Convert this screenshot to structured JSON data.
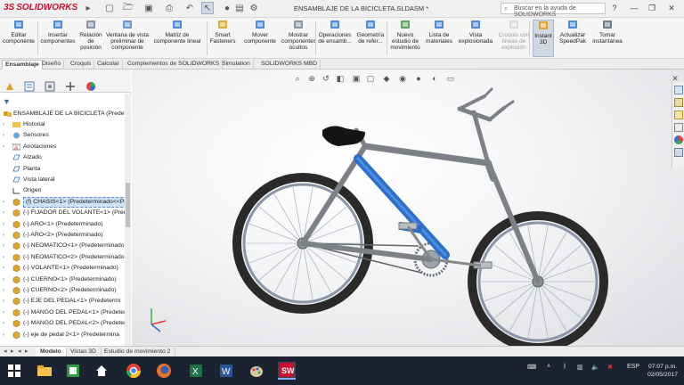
{
  "app": {
    "logo_prefix": "3S",
    "logo_text": "SOLIDWORKS"
  },
  "document_title": "ENSAMBLAJE DE LA BICICLETA.SLDASM *",
  "search": {
    "placeholder": "Buscar en la ayuda de SOLIDWORKS"
  },
  "ribbon": [
    {
      "label": "Editar componente",
      "icon": "edit-component-icon",
      "disabled": false
    },
    {
      "label": "Insertar componentes",
      "icon": "insert-components-icon",
      "disabled": false
    },
    {
      "label": "Relación de posición",
      "icon": "mate-icon",
      "disabled": false
    },
    {
      "label": "Ventana de vista preliminar de componente",
      "icon": "preview-window-icon",
      "disabled": false
    },
    {
      "label": "Matriz de componente lineal",
      "icon": "linear-pattern-icon",
      "disabled": false
    },
    {
      "label": "Smart Fasteners",
      "icon": "smart-fasteners-icon",
      "disabled": false
    },
    {
      "label": "Mover componente",
      "icon": "move-component-icon",
      "disabled": false
    },
    {
      "label": "Mostrar componentes ocultos",
      "icon": "show-hidden-icon",
      "disabled": false
    },
    {
      "label": "Operaciones de ensamb...",
      "icon": "assembly-features-icon",
      "disabled": false
    },
    {
      "label": "Geometría de refer...",
      "icon": "reference-geometry-icon",
      "disabled": false
    },
    {
      "label": "Nuevo estudio de movimiento",
      "icon": "motion-study-icon",
      "disabled": false
    },
    {
      "label": "Lista de materiales",
      "icon": "bom-icon",
      "disabled": false
    },
    {
      "label": "Vista explosionada",
      "icon": "exploded-view-icon",
      "disabled": false
    },
    {
      "label": "Croquis con líneas de explosión",
      "icon": "explode-line-sketch-icon",
      "disabled": true
    },
    {
      "label": "Instant 3D",
      "icon": "instant3d-icon",
      "disabled": false
    },
    {
      "label": "Actualizar SpeedPak",
      "icon": "speedpak-icon",
      "disabled": false
    },
    {
      "label": "Tomar instantánea",
      "icon": "snapshot-icon",
      "disabled": false
    }
  ],
  "command_tabs": [
    "Ensamblaje",
    "Diseño",
    "Croquis",
    "Calcular",
    "Complementos de SOLIDWORKS",
    "Simulation",
    "SOLIDWORKS MBD"
  ],
  "tree": {
    "root": "ENSAMBLAJE DE LA BICICLETA (Predeterm",
    "items": [
      {
        "label": "Historial",
        "type": "folder"
      },
      {
        "label": "Sensores",
        "type": "sensor"
      },
      {
        "label": "Anotaciones",
        "type": "annotation"
      },
      {
        "label": "Alzado",
        "type": "plane"
      },
      {
        "label": "Planta",
        "type": "plane"
      },
      {
        "label": "Vista lateral",
        "type": "plane"
      },
      {
        "label": "Origen",
        "type": "origin"
      },
      {
        "label": "(f) CHASIS<1> (Predeterminado<<Pre",
        "type": "part",
        "selected": true
      },
      {
        "label": "(-) FIJADOR DEL VOLANTE<1> (Prede",
        "type": "part"
      },
      {
        "label": "(-) ARO<1> (Predeterminado)",
        "type": "part"
      },
      {
        "label": "(-) ARO<2> (Predeterminado)",
        "type": "part"
      },
      {
        "label": "(-) NEOMATICO<1> (Predeterminado)",
        "type": "part"
      },
      {
        "label": "(-) NEOMATICO<2> (Predeterminado)",
        "type": "part"
      },
      {
        "label": "(-) VOLANTE<1> (Predeterminado)",
        "type": "part"
      },
      {
        "label": "(-) CUERNO<1> (Predeterminado)",
        "type": "part"
      },
      {
        "label": "(-) CUERNO<2> (Predeterminado)",
        "type": "part"
      },
      {
        "label": "(-) EJE DEL PEDAL<1> (Predetermi",
        "type": "part"
      },
      {
        "label": "(-) MANGO DEL PEDAL<1> (Predeter",
        "type": "part"
      },
      {
        "label": "(-) MANGO DEL PEDAL<2> (Predeter",
        "type": "part"
      },
      {
        "label": "(-) eje de pedal 2<1> (Predetermina",
        "type": "part"
      }
    ]
  },
  "bottom_tabs": [
    "Modelo",
    "Vistas 3D",
    "Estudio de movimiento 2"
  ],
  "taskbar": {
    "language": "ESP",
    "time": "07:07 p.m.",
    "date": "02/05/2017",
    "apps": [
      "file-explorer-icon",
      "store-icon",
      "chrome-icon",
      "firefox-icon",
      "excel-icon",
      "word-icon",
      "paint-icon",
      "solidworks-app-icon"
    ]
  },
  "colors": {
    "frame_blue": "#2b6fc9",
    "frame_grey": "#7d8187",
    "solidworks_red": "#c8102e",
    "taskbar": "#1b2331"
  }
}
